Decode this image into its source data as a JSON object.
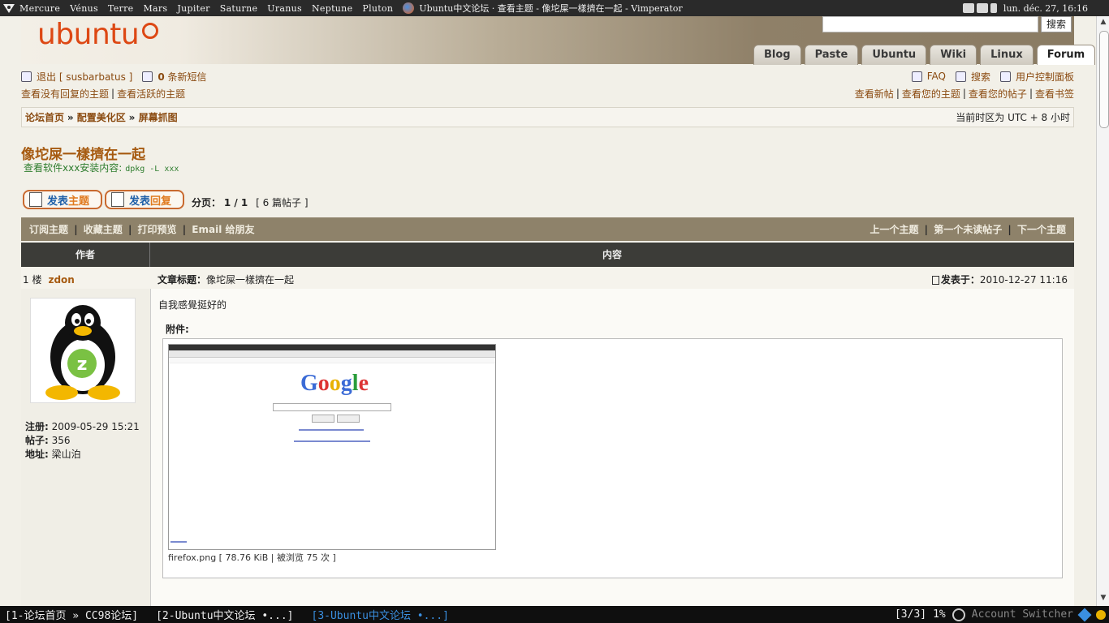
{
  "topbar": {
    "workspaces": [
      "Mercure",
      "Vénus",
      "Terre",
      "Mars",
      "Jupiter",
      "Saturne",
      "Uranus",
      "Neptune",
      "Pluton"
    ],
    "window_title": "Ubuntu中文论坛 · 查看主题 - 像坨屎一樣擠在一起 - Vimperator",
    "clock": "lun. déc. 27, 16:16"
  },
  "header": {
    "logo_text": "ubuntu",
    "search_button": "搜索",
    "tabs": [
      "Blog",
      "Paste",
      "Ubuntu",
      "Wiki",
      "Linux",
      "Forum"
    ],
    "active_tab": "Forum"
  },
  "userbar": {
    "logout": "退出 [ susbarbatus ]",
    "pm_count": "0",
    "pm_label": "条新短信",
    "faq": "FAQ",
    "search": "搜索",
    "ucp": "用户控制面板"
  },
  "quicklinks": {
    "left": [
      "查看没有回复的主题",
      "查看活跃的主题"
    ],
    "right": [
      "查看新帖",
      "查看您的主题",
      "查看您的帖子",
      "查看书签"
    ]
  },
  "breadcrumb": {
    "items": [
      "论坛首页",
      "配置美化区",
      "屏幕抓图"
    ],
    "timezone": "当前时区为 UTC + 8 小时"
  },
  "topic": {
    "title": "像坨屎一樣擠在一起",
    "desc_label": "查看软件xxx安装内容:",
    "desc_code": "dpkg -L xxx"
  },
  "buttons": {
    "new_topic_a": "发表",
    "new_topic_b": "主题",
    "reply_a": "发表",
    "reply_b": "回复"
  },
  "pagination": {
    "label": "分页：",
    "value": "1 / 1",
    "posts": "[ 6 篇帖子 ]"
  },
  "toolbar": {
    "left": [
      "订阅主题",
      "收藏主题",
      "打印预览",
      "Email 给朋友"
    ],
    "right": [
      "上一个主题",
      "第一个未读帖子",
      "下一个主题"
    ]
  },
  "table_header": {
    "author": "作者",
    "content": "内容"
  },
  "post": {
    "floor": "1 楼",
    "author": "zdon",
    "subject_label": "文章标题：",
    "subject": "像坨屎一樣擠在一起",
    "posted_label": "发表于：",
    "posted_time": "2010-12-27 11:16",
    "body": "自我感覺挺好的",
    "attachment_label": "附件:",
    "attachment_caption": "firefox.png [ 78.76 KiB | 被浏览 75 次 ]",
    "profile": {
      "reg_label": "注册:",
      "reg_value": "2009-05-29 15:21",
      "posts_label": "帖子:",
      "posts_value": "356",
      "loc_label": "地址:",
      "loc_value": "梁山泊"
    }
  },
  "statusbar": {
    "tabs": [
      "[1-论坛首页 » CC98论坛]",
      "[2-Ubuntu中文论坛 •...]",
      "[3-Ubuntu中文论坛 •...]"
    ],
    "position": "[3/3]",
    "percent": "1%",
    "account_switcher": "Account Switcher"
  },
  "colors": {
    "ubuntu_orange": "#dd4814",
    "link_brown": "#8a4a10",
    "title_orange": "#a65a10",
    "desc_green": "#2e7d2e",
    "toolbar_taupe": "#8e826a"
  }
}
